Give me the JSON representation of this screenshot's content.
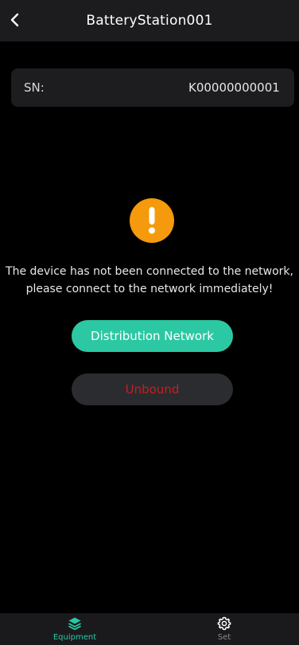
{
  "header": {
    "title": "BatteryStation001"
  },
  "device": {
    "sn_label": "SN:",
    "sn_value": "K00000000001"
  },
  "status": {
    "message_line1": "The device has not been connected to the network,",
    "message_line2": "please connect to the network immediately!"
  },
  "actions": {
    "network_label": "Distribution Network",
    "unbound_label": "Unbound"
  },
  "tabbar": {
    "tabs": [
      {
        "label": "Equipment",
        "icon": "layers-icon",
        "active": true
      },
      {
        "label": "Set",
        "icon": "gear-icon",
        "active": false
      }
    ]
  },
  "colors": {
    "accent": "#2bc8a3",
    "warning": "#f59a0c",
    "danger": "#c81e1e",
    "background": "#000000"
  }
}
